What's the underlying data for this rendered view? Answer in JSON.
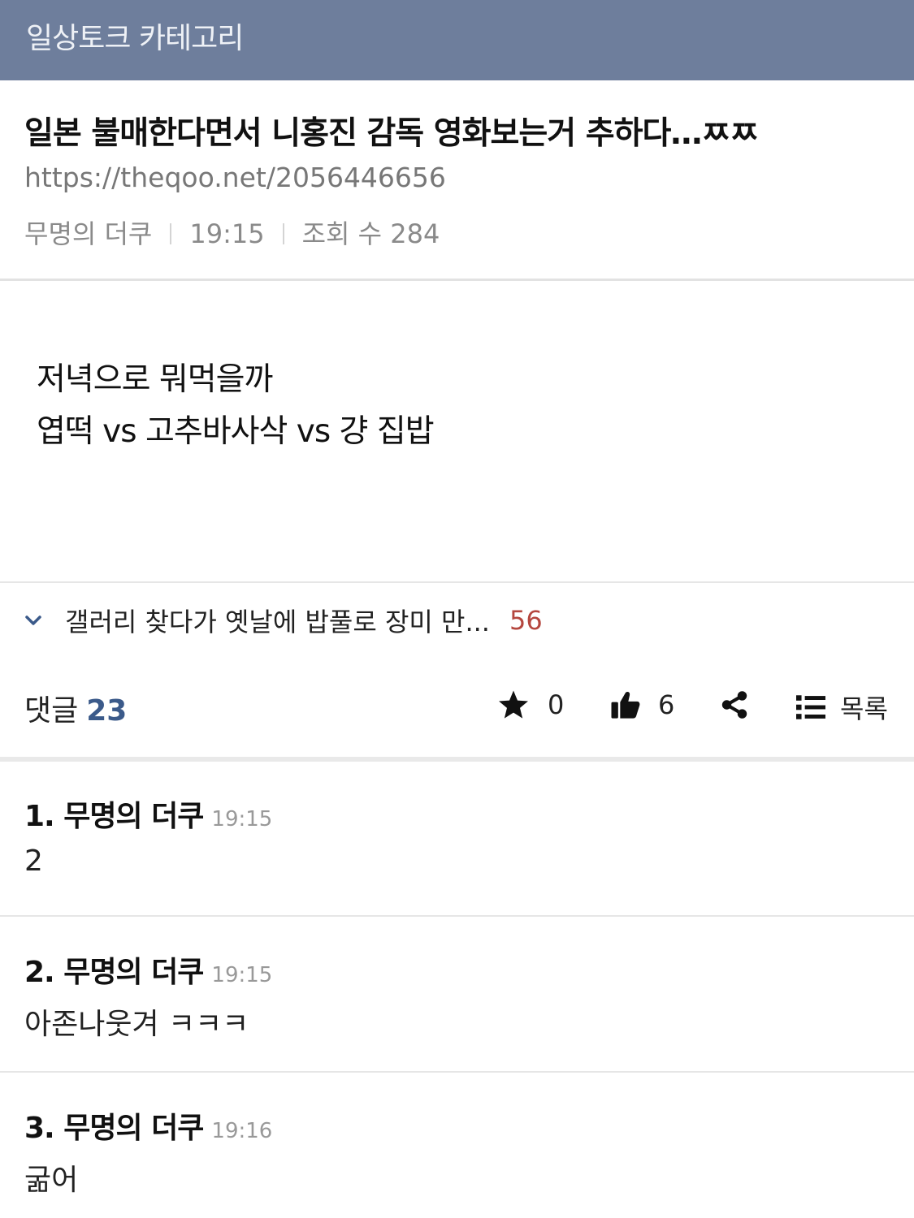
{
  "header": {
    "category_title": "일상토크 카테고리"
  },
  "post": {
    "title": "일본 불매한다면서 니홍진 감독 영화보는거 추하다…ㅉㅉ",
    "url": "https://theqoo.net/2056446656",
    "author": "무명의 더쿠",
    "time": "19:15",
    "views_label": "조회 수 284",
    "body_lines": [
      "저녁으로 뭐먹을까",
      "엽떡 vs 고추바사삭 vs 걍 집밥"
    ]
  },
  "related": {
    "title": "갤러리 찾다가 옛날에 밥풀로 장미 만...",
    "count": "56"
  },
  "actions": {
    "comment_label": "댓글",
    "comment_count": "23",
    "star_count": "0",
    "like_count": "6",
    "list_label": "목록"
  },
  "comments": [
    {
      "number_name": "1. 무명의 더쿠",
      "time": "19:15",
      "text": "2"
    },
    {
      "number_name": "2. 무명의 더쿠",
      "time": "19:15",
      "text": "아존나웃겨 ㅋㅋㅋ"
    },
    {
      "number_name": "3. 무명의 더쿠",
      "time": "19:16",
      "text": "굶어"
    }
  ],
  "colors": {
    "header_bg": "#6e7e9c",
    "count_accent": "#3b5a8a",
    "related_count": "#b5473f"
  },
  "icons": [
    "chevron-down-icon",
    "star-icon",
    "thumbs-up-icon",
    "share-icon",
    "list-icon"
  ]
}
